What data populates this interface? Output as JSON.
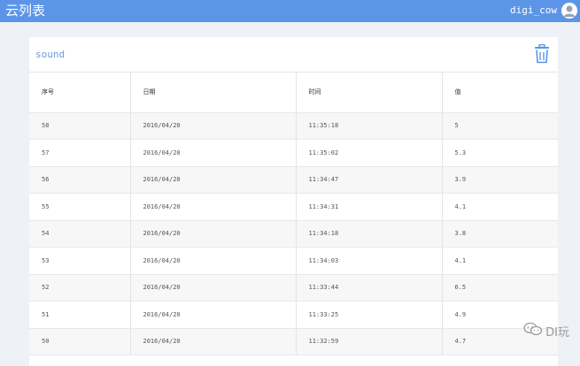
{
  "header": {
    "app_title": "云列表",
    "username": "digi_cow"
  },
  "card": {
    "title": "sound",
    "delete_icon": "trash-icon"
  },
  "table": {
    "columns": [
      "序号",
      "日期",
      "时间",
      "值"
    ],
    "rows": [
      [
        "58",
        "2016/04/20",
        "11:35:18",
        "5"
      ],
      [
        "57",
        "2016/04/20",
        "11:35:02",
        "5.3"
      ],
      [
        "56",
        "2016/04/20",
        "11:34:47",
        "3.9"
      ],
      [
        "55",
        "2016/04/20",
        "11:34:31",
        "4.1"
      ],
      [
        "54",
        "2016/04/20",
        "11:34:18",
        "3.8"
      ],
      [
        "53",
        "2016/04/20",
        "11:34:03",
        "4.1"
      ],
      [
        "52",
        "2016/04/20",
        "11:33:44",
        "6.5"
      ],
      [
        "51",
        "2016/04/20",
        "11:33:25",
        "4.9"
      ],
      [
        "50",
        "2016/04/20",
        "11:32:59",
        "4.7"
      ]
    ]
  },
  "watermark": {
    "text": "DI玩",
    "icon": "wechat-icon"
  },
  "colors": {
    "topbar": "#5b95e8",
    "title_accent": "#6a9be0",
    "background": "#eef1f6"
  }
}
